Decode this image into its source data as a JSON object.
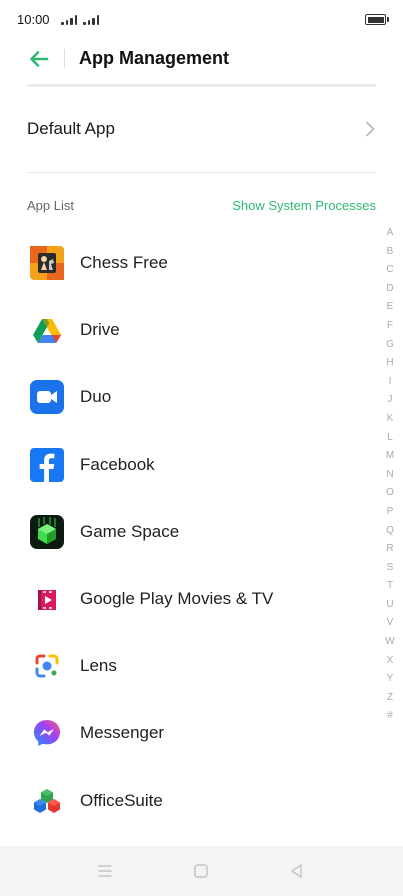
{
  "status_bar": {
    "time": "10:00"
  },
  "header": {
    "title": "App Management"
  },
  "default_app": {
    "label": "Default App"
  },
  "app_list": {
    "label": "App List",
    "show_system_label": "Show System Processes",
    "apps": [
      {
        "name": "Chess Free",
        "icon": "chess-free-icon"
      },
      {
        "name": "Drive",
        "icon": "drive-icon"
      },
      {
        "name": "Duo",
        "icon": "duo-icon"
      },
      {
        "name": "Facebook",
        "icon": "facebook-icon"
      },
      {
        "name": "Game Space",
        "icon": "game-space-icon"
      },
      {
        "name": "Google Play Movies & TV",
        "icon": "play-movies-icon"
      },
      {
        "name": "Lens",
        "icon": "lens-icon"
      },
      {
        "name": "Messenger",
        "icon": "messenger-icon"
      },
      {
        "name": "OfficeSuite",
        "icon": "officesuite-icon"
      }
    ]
  },
  "alpha_index": [
    "A",
    "B",
    "C",
    "D",
    "E",
    "F",
    "G",
    "H",
    "I",
    "J",
    "K",
    "L",
    "M",
    "N",
    "O",
    "P",
    "Q",
    "R",
    "S",
    "T",
    "U",
    "V",
    "W",
    "X",
    "Y",
    "Z",
    "#"
  ],
  "colors": {
    "accent": "#2eb871",
    "facebook": "#1877f2",
    "duo": "#1a73e8"
  }
}
